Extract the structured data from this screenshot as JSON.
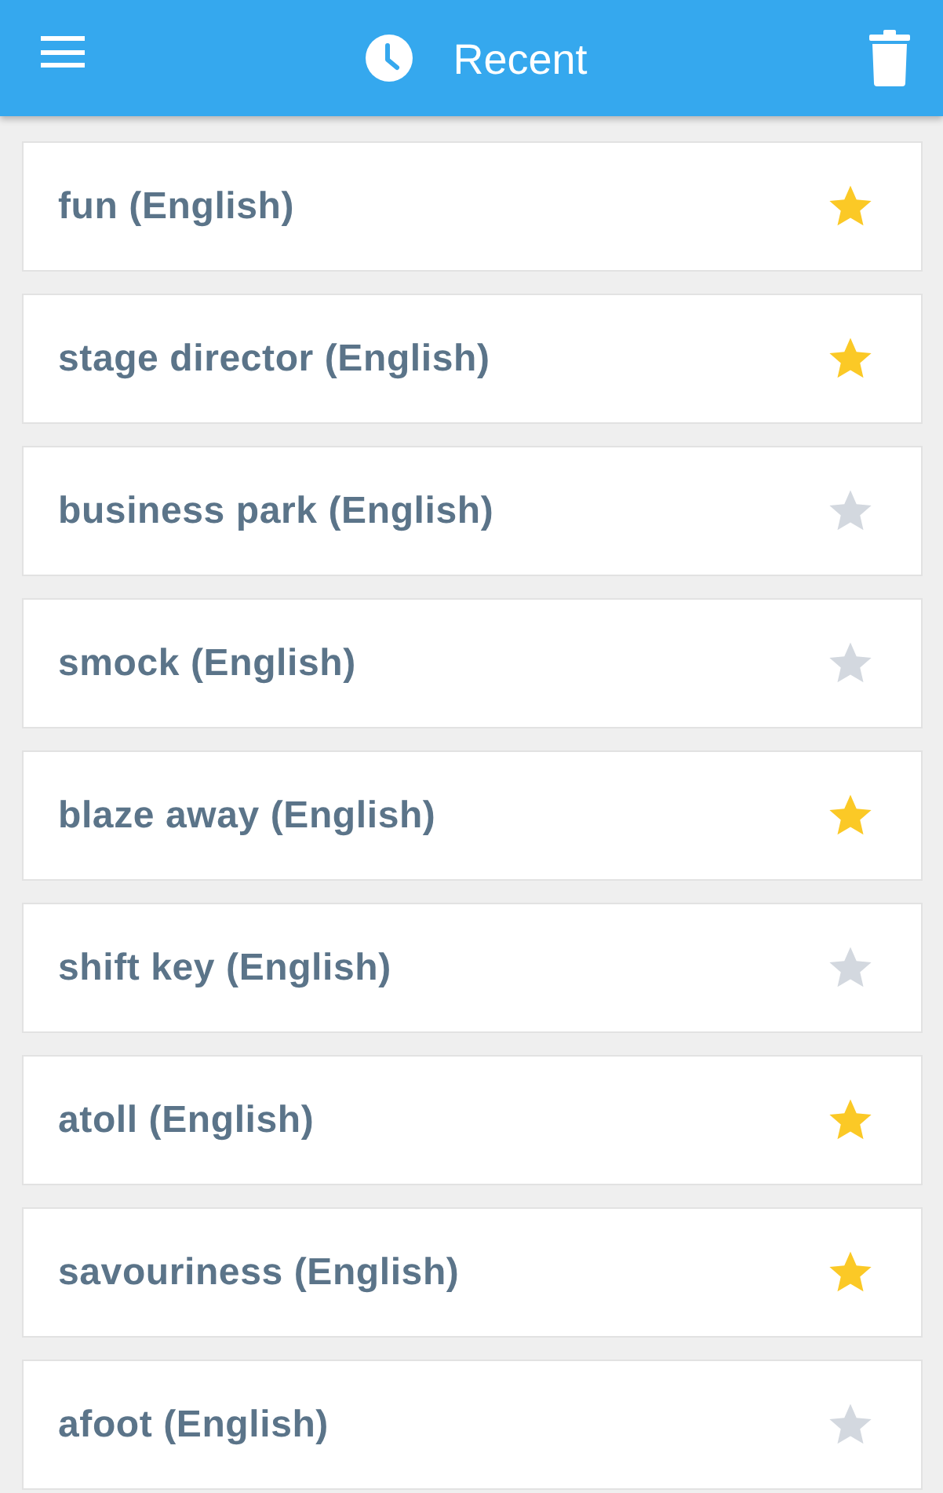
{
  "header": {
    "title": "Recent"
  },
  "items": [
    {
      "label": "fun (English)",
      "favorite": true
    },
    {
      "label": "stage director (English)",
      "favorite": true
    },
    {
      "label": "business park (English)",
      "favorite": false
    },
    {
      "label": "smock (English)",
      "favorite": false
    },
    {
      "label": "blaze away (English)",
      "favorite": true
    },
    {
      "label": "shift key (English)",
      "favorite": false
    },
    {
      "label": "atoll (English)",
      "favorite": true
    },
    {
      "label": "savouriness (English)",
      "favorite": true
    },
    {
      "label": "afoot (English)",
      "favorite": false
    }
  ]
}
